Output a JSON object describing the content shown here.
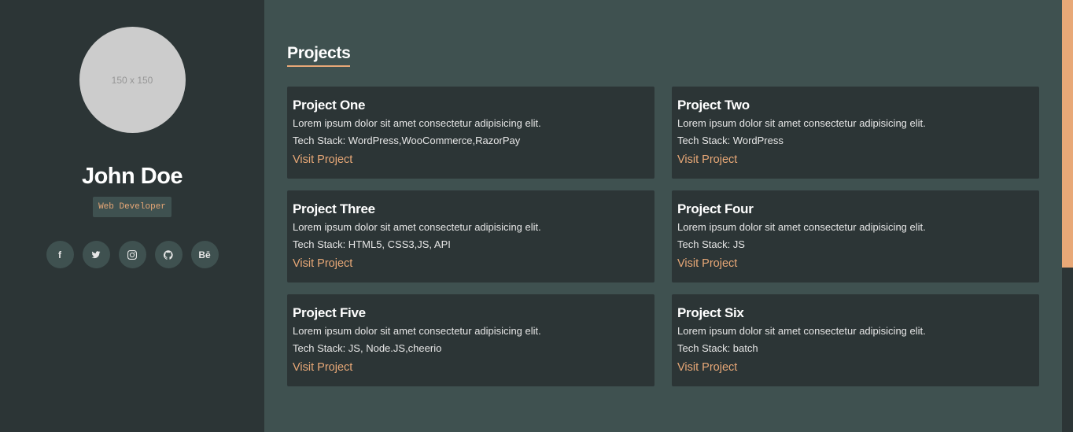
{
  "profile": {
    "avatar_placeholder": "150 x 150",
    "name": "John Doe",
    "role": "Web Developer"
  },
  "socials": [
    {
      "icon": "facebook-icon",
      "glyph": "f"
    },
    {
      "icon": "twitter-icon",
      "glyph": ""
    },
    {
      "icon": "instagram-icon",
      "glyph": ""
    },
    {
      "icon": "github-icon",
      "glyph": ""
    },
    {
      "icon": "behance-icon",
      "glyph": "Bē"
    }
  ],
  "projects_section": {
    "heading": "Projects",
    "items": [
      {
        "title": "Project One",
        "desc": "Lorem ipsum dolor sit amet consectetur adipisicing elit.",
        "stack": "Tech Stack: WordPress,WooCommerce,RazorPay",
        "link": "Visit Project"
      },
      {
        "title": "Project Two",
        "desc": "Lorem ipsum dolor sit amet consectetur adipisicing elit.",
        "stack": "Tech Stack: WordPress",
        "link": "Visit Project"
      },
      {
        "title": "Project Three",
        "desc": "Lorem ipsum dolor sit amet consectetur adipisicing elit.",
        "stack": "Tech Stack: HTML5, CSS3,JS, API",
        "link": "Visit Project"
      },
      {
        "title": "Project Four",
        "desc": "Lorem ipsum dolor sit amet consectetur adipisicing elit.",
        "stack": "Tech Stack: JS",
        "link": "Visit Project"
      },
      {
        "title": "Project Five",
        "desc": "Lorem ipsum dolor sit amet consectetur adipisicing elit.",
        "stack": "Tech Stack: JS, Node.JS,cheerio",
        "link": "Visit Project"
      },
      {
        "title": "Project Six",
        "desc": "Lorem ipsum dolor sit amet consectetur adipisicing elit.",
        "stack": "Tech Stack: batch",
        "link": "Visit Project"
      }
    ]
  },
  "colors": {
    "sidebar_bg": "#2c3536",
    "main_bg": "#3f5150",
    "accent": "#e8a877"
  }
}
